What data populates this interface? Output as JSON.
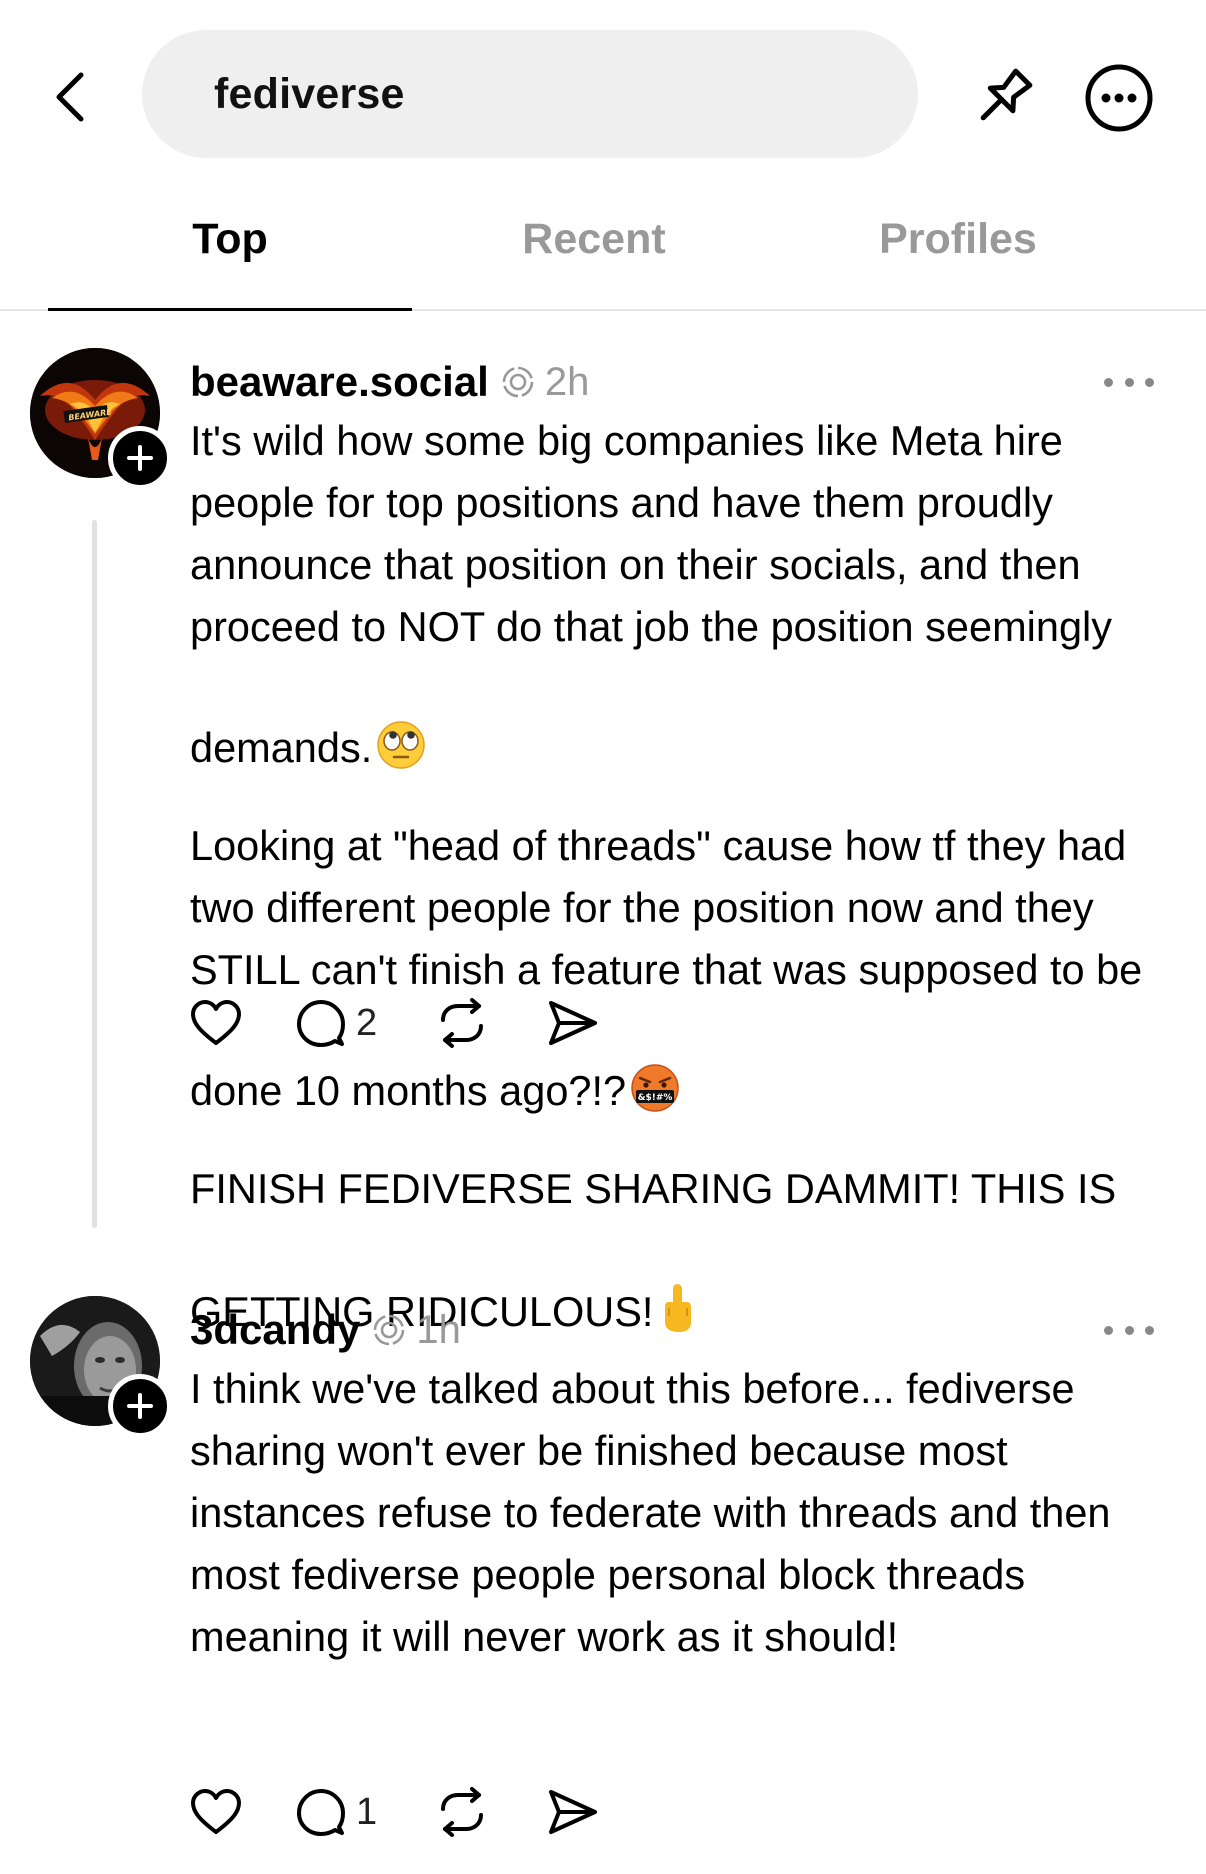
{
  "header": {
    "search_query": "fediverse",
    "icons": [
      "chevron-left-icon",
      "pin-icon",
      "more-circle-icon"
    ]
  },
  "tabs": [
    {
      "label": "Top",
      "active": true
    },
    {
      "label": "Recent",
      "active": false
    },
    {
      "label": "Profiles",
      "active": false
    }
  ],
  "posts": [
    {
      "username": "beaware.social",
      "time": "2h",
      "paragraphs": [
        "It's wild how some big companies like Meta hire people for top positions and have them proudly announce that position on their socials, and then proceed to NOT do that job the position seemingly demands.",
        "Looking at \"head of threads\" cause how tf they had two different people for the position now and they STILL can't finish a feature that was supposed to be done 10 months ago?!?",
        "FINISH FEDIVERSE SHARING DAMMIT! THIS IS GETTING RIDICULOUS!"
      ],
      "emojis": [
        "eye-roll-emoji",
        "cursing-face-emoji",
        "middle-finger-emoji"
      ],
      "reply_count": "2"
    },
    {
      "username": "3dcandy",
      "time": "1h",
      "paragraphs": [
        "I think we've talked about this before... fediverse sharing won't ever be finished because most instances refuse to federate with threads and then most fediverse people personal block threads meaning it will never work as it should!"
      ],
      "reply_count": "1"
    }
  ],
  "colors": {
    "accent": "#000000",
    "muted": "#999999",
    "search_bg": "#efefef",
    "divider": "#e6e6e6"
  }
}
